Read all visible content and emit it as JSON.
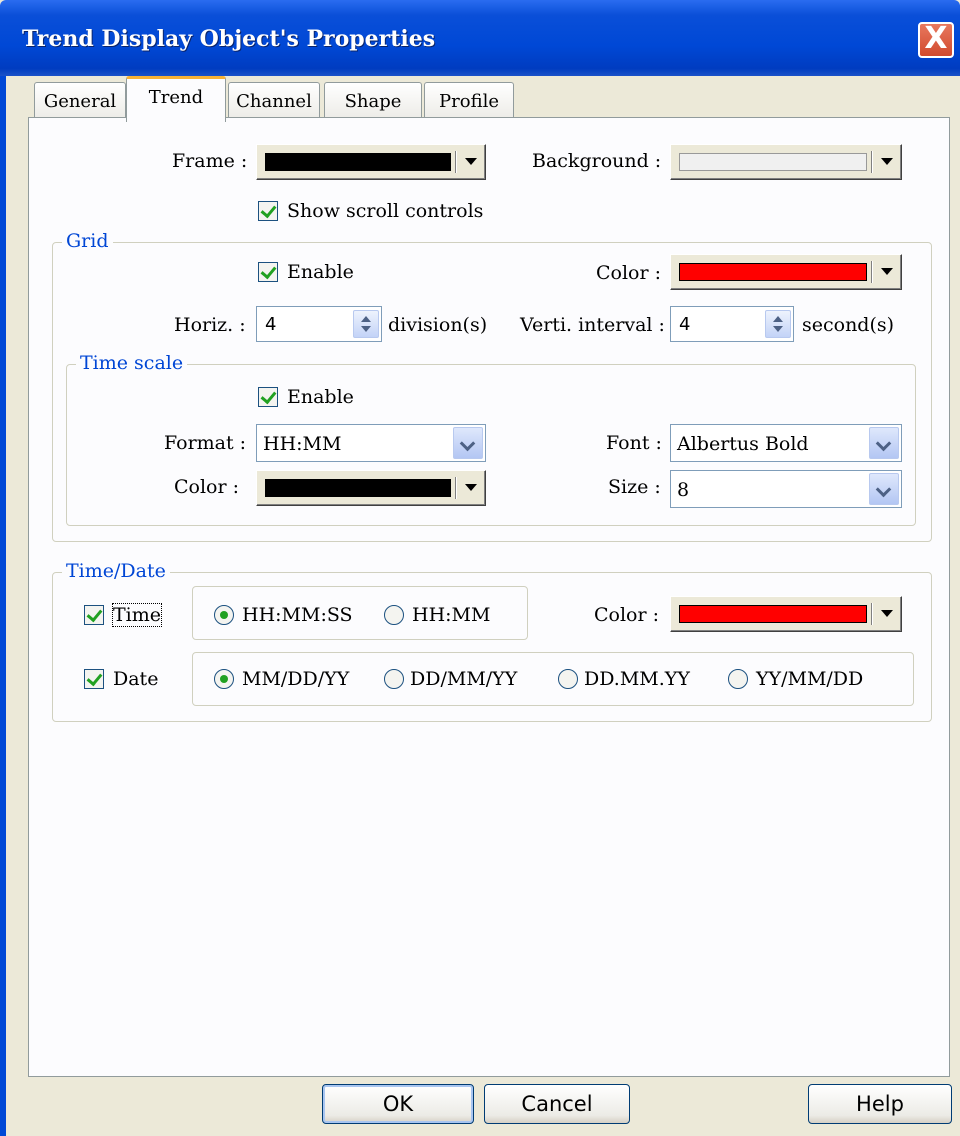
{
  "window": {
    "title": "Trend Display Object's Properties",
    "close_glyph": "X"
  },
  "tabs": [
    {
      "label": "General"
    },
    {
      "label": "Trend"
    },
    {
      "label": "Channel"
    },
    {
      "label": "Shape"
    },
    {
      "label": "Profile"
    }
  ],
  "active_tab": "Trend",
  "top": {
    "frame_label": "Frame :",
    "frame_color": "#000000",
    "background_label": "Background :",
    "background_color": "#f0f0f0",
    "show_scroll_label": "Show scroll controls",
    "show_scroll_checked": true
  },
  "grid": {
    "title": "Grid",
    "enable_label": "Enable",
    "enable_checked": true,
    "color_label": "Color :",
    "color": "#ff0000",
    "horiz_label": "Horiz. :",
    "horiz_value": "4",
    "horiz_unit": "division(s)",
    "verti_label": "Verti. interval :",
    "verti_value": "4",
    "verti_unit": "second(s)"
  },
  "time_scale": {
    "title": "Time scale",
    "enable_label": "Enable",
    "enable_checked": true,
    "format_label": "Format :",
    "format_value": "HH:MM",
    "font_label": "Font :",
    "font_value": "Albertus Bold",
    "color_label": "Color :",
    "color": "#000000",
    "size_label": "Size :",
    "size_value": "8"
  },
  "time_date": {
    "title": "Time/Date",
    "time_label": "Time",
    "time_checked": true,
    "time_options": [
      "HH:MM:SS",
      "HH:MM"
    ],
    "time_selected": "HH:MM:SS",
    "color_label": "Color :",
    "color": "#ff0000",
    "date_label": "Date",
    "date_checked": true,
    "date_options": [
      "MM/DD/YY",
      "DD/MM/YY",
      "DD.MM.YY",
      "YY/MM/DD"
    ],
    "date_selected": "MM/DD/YY"
  },
  "buttons": {
    "ok": "OK",
    "cancel": "Cancel",
    "help": "Help"
  }
}
